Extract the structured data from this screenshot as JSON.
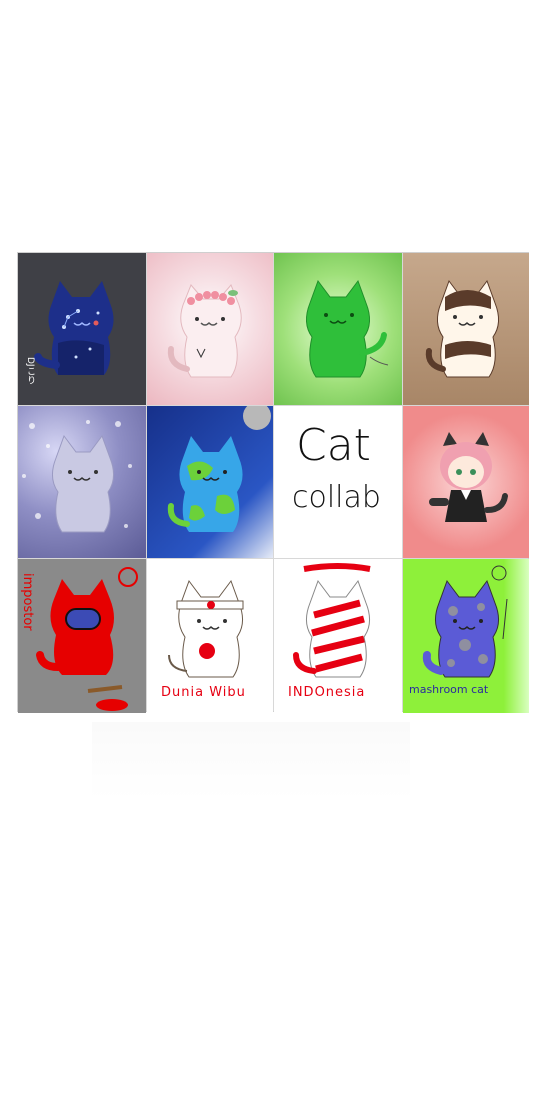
{
  "artwork": {
    "tile1_signature": "DJこり",
    "tile7_title_line1": "Cat",
    "tile7_title_line2": "collab",
    "tile9_caption": "impostor",
    "tile10_caption": "Dunia Wibu",
    "tile11_caption": "INDOnesia",
    "tile12_caption": "mashroom cat"
  },
  "colors": {
    "tile1_bg": "#3f4046",
    "tile2_bg": "#f3c9cf",
    "tile3_bg": "#9fe07a",
    "tile4_bg": "#b08f72",
    "tile5_bg": "#6f6fa8",
    "tile6_bg": "#1e3f9a",
    "tile7_bg": "#ffffff",
    "tile8_bg": "#f07f82",
    "tile9_bg": "#8c8c8c",
    "tile10_bg": "#ffffff",
    "tile11_bg": "#ffffff",
    "tile12_bg": "#8ef03a"
  }
}
